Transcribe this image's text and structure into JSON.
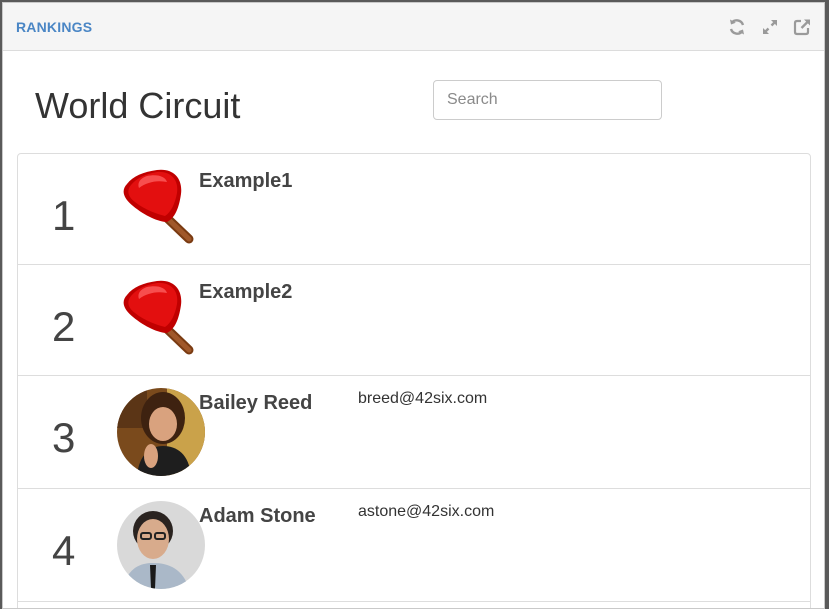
{
  "panel": {
    "title": "RANKINGS",
    "icons": [
      "refresh-icon",
      "expand-icon",
      "popout-icon"
    ]
  },
  "main": {
    "heading": "World Circuit",
    "search": {
      "placeholder": "Search",
      "value": ""
    }
  },
  "rankings": [
    {
      "rank": "1",
      "name": "Example1",
      "email": "",
      "avatar": "ping-pong-paddle-icon"
    },
    {
      "rank": "2",
      "name": "Example2",
      "email": "",
      "avatar": "ping-pong-paddle-icon"
    },
    {
      "rank": "3",
      "name": "Bailey Reed",
      "email": "breed@42six.com",
      "avatar": "user-photo"
    },
    {
      "rank": "4",
      "name": "Adam Stone",
      "email": "astone@42six.com",
      "avatar": "user-photo"
    }
  ],
  "colors": {
    "title": "#4a86c5",
    "paddle": "#d40000",
    "text": "#444444"
  }
}
